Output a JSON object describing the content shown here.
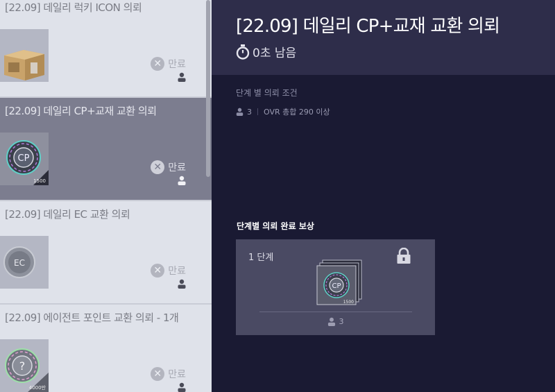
{
  "requests": [
    {
      "title": "[22.09] 데일리 럭키 ICON 의뢰",
      "status": "만료",
      "thumb_icon": "box-icon",
      "thumb_value": ""
    },
    {
      "title": "[22.09] 데일리 CP+교재 교환 의뢰",
      "status": "만료",
      "thumb_icon": "cp-coin-icon",
      "thumb_value": "1500"
    },
    {
      "title": "[22.09] 데일리 EC 교환 의뢰",
      "status": "만료",
      "thumb_icon": "ec-coin-icon",
      "thumb_value": ""
    },
    {
      "title": "[22.09] 에이전트 포인트 교환 의뢰 - 1개",
      "status": "만료",
      "thumb_icon": "question-coin-icon",
      "thumb_value": "4000만"
    }
  ],
  "detail": {
    "title": "[22.09] 데일리 CP+교재 교환 의뢰",
    "timer": "0초 남음",
    "condition_label": "단계 별 의뢰 조건",
    "condition_count": "3",
    "condition_text": "OVR 총합 290 이상",
    "reward_label": "단계별 의뢰 완료 보상",
    "reward": {
      "stage": "1 단계",
      "item_value": "1500",
      "users": "3"
    }
  },
  "colors": {
    "list_bg": "#dfe2ea",
    "list_selected": "#7c7d8f",
    "detail_bg": "#1a1a33",
    "header_bg": "#2e2d4a",
    "card_bg": "#4a4a63"
  }
}
